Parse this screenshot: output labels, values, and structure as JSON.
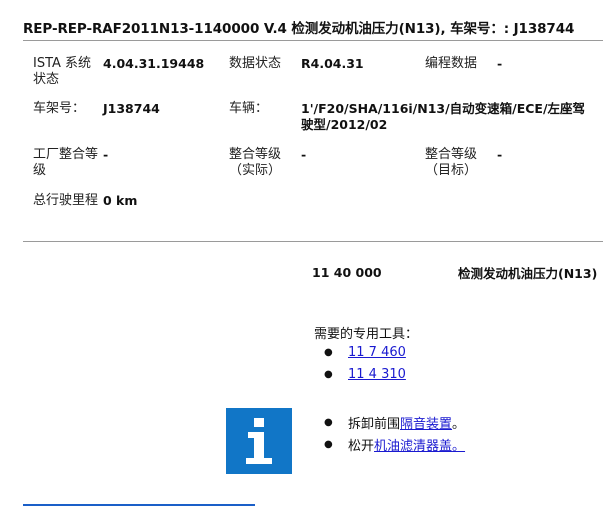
{
  "title": "REP-REP-RAF2011N13-1140000   V.4   检测发动机油压力(N13), 车架号：: J138744",
  "info": {
    "rows": [
      [
        {
          "label": "ISTA 系统状态",
          "value": "4.04.31.19448"
        },
        {
          "label": "数据状态",
          "value": "R4.04.31"
        },
        {
          "label": "编程数据",
          "value": "-"
        }
      ],
      [
        {
          "label": "车架号：",
          "value": "J138744"
        },
        {
          "label": "车辆：",
          "value": "1'/F20/SHA/116i/N13/自动变速箱/ECE/左座驾驶型/2012/02"
        }
      ],
      [
        {
          "label": "工厂整合等级",
          "value": "-"
        },
        {
          "label": "整合等级（实际）",
          "value": "-"
        },
        {
          "label": "整合等级（目标）",
          "value": "-"
        }
      ],
      [
        {
          "label": "总行驶里程",
          "value": "0 km"
        }
      ]
    ]
  },
  "procedure": {
    "number": "11 40 000",
    "name": "检测发动机油压力(N13)"
  },
  "tools": {
    "heading": "需要的专用工具：",
    "items": [
      "11 7 460",
      "11 4 310"
    ]
  },
  "steps": [
    {
      "prefix": "拆卸前围",
      "link": "隔音装置",
      "suffix": "。"
    },
    {
      "prefix": "松开",
      "link": "机油滤清器盖",
      "suffix": "。"
    }
  ],
  "colors": {
    "info_icon_bg": "#1176c7",
    "link": "#1a1ad0"
  }
}
